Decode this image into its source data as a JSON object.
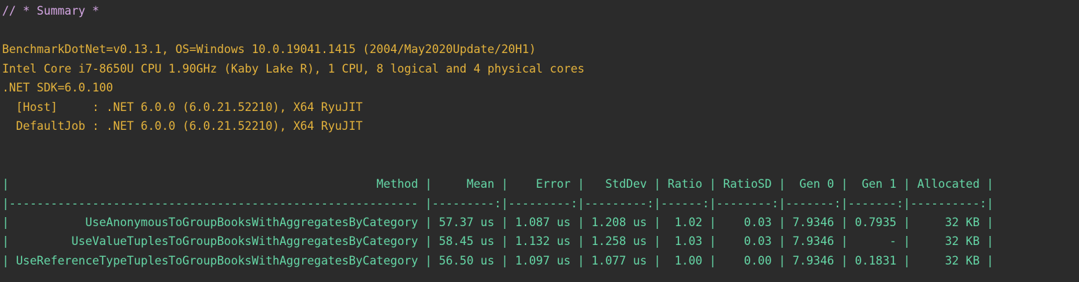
{
  "header": {
    "summary": "// * Summary *"
  },
  "environment": {
    "lines": [
      "BenchmarkDotNet=v0.13.1, OS=Windows 10.0.19041.1415 (2004/May2020Update/20H1)",
      "Intel Core i7-8650U CPU 1.90GHz (Kaby Lake R), 1 CPU, 8 logical and 4 physical cores",
      ".NET SDK=6.0.100",
      "  [Host]     : .NET 6.0.0 (6.0.21.52210), X64 RyuJIT",
      "  DefaultJob : .NET 6.0.0 (6.0.21.52210), X64 RyuJIT"
    ]
  },
  "results_table": {
    "header_line": "|                                                     Method |     Mean |    Error |   StdDev | Ratio | RatioSD |  Gen 0 |  Gen 1 | Allocated |",
    "separator_line": "|----------------------------------------------------------- |---------:|---------:|---------:|------:|--------:|-------:|-------:|----------:|",
    "rows": [
      "|           UseAnonymousToGroupBooksWithAggregatesByCategory | 57.37 us | 1.087 us | 1.208 us |  1.02 |    0.03 | 7.9346 | 0.7935 |     32 KB |",
      "|         UseValueTuplesToGroupBooksWithAggregatesByCategory | 58.45 us | 1.132 us | 1.258 us |  1.03 |    0.03 | 7.9346 |      - |     32 KB |",
      "| UseReferenceTypeTuplesToGroupBooksWithAggregatesByCategory | 56.50 us | 1.097 us | 1.077 us |  1.00 |    0.00 | 7.9346 | 0.1831 |     32 KB |"
    ]
  },
  "colors": {
    "background": "#2b2b2b",
    "summary_text": "#d4a6e3",
    "environment_text": "#e3b23c",
    "table_text": "#65d6a6"
  }
}
